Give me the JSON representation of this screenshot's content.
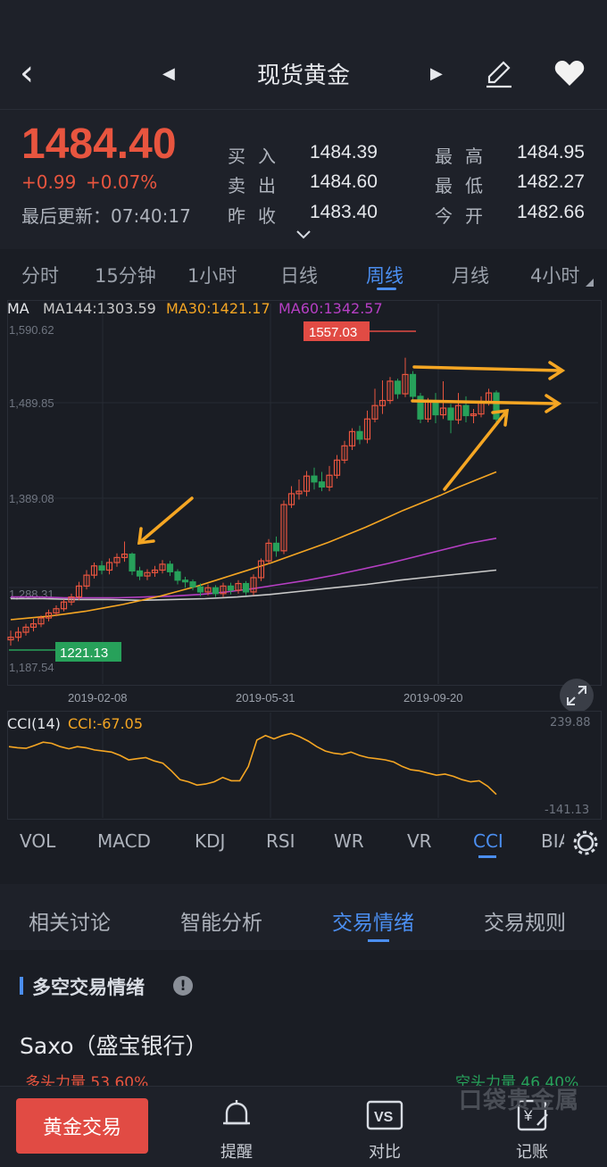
{
  "header": {
    "title": "现货黄金",
    "back_icon": "‹",
    "prev_icon": "◀",
    "next_icon": "▶"
  },
  "quote": {
    "price": "1484.40",
    "change": "+0.99",
    "change_pct": "+0.07%",
    "last_update": "最后更新：07:40:17",
    "buy_label": "买入",
    "buy": "1484.39",
    "sell_label": "卖出",
    "sell": "1484.60",
    "prev_label": "昨收",
    "prev": "1483.40",
    "high_label": "最高",
    "high": "1484.95",
    "low_label": "最低",
    "low": "1482.27",
    "open_label": "今开",
    "open": "1482.66"
  },
  "timeframes": [
    "分时",
    "15分钟",
    "1小时",
    "日线",
    "周线",
    "月线",
    "4小时"
  ],
  "active_timeframe": "周线",
  "ma_legend": {
    "ma": "MA",
    "ma144": "MA144:1303.59",
    "ma30": "MA30:1421.17",
    "ma60": "MA60:1342.57"
  },
  "price_axis": [
    "1,590.62",
    "1,489.85",
    "1,389.08",
    "1,288.31",
    "1,187.54"
  ],
  "date_axis": [
    "2019-02-08",
    "2019-05-31",
    "2019-09-20"
  ],
  "labels": {
    "max": "1557.03",
    "min": "1221.13"
  },
  "cci": {
    "title": "CCI(14)",
    "value": "CCI:-67.05",
    "top": "239.88",
    "bottom": "-141.13"
  },
  "indicators": [
    "VOL",
    "MACD",
    "KDJ",
    "RSI",
    "WR",
    "VR",
    "CCI",
    "BIA"
  ],
  "active_indicator": "CCI",
  "sections": [
    "相关讨论",
    "智能分析",
    "交易情绪",
    "交易规则"
  ],
  "active_section": "交易情绪",
  "sentiment": {
    "heading": "多空交易情绪",
    "broker": "Saxo（盛宝银行）",
    "long": "多头力量 53.60%",
    "short": "空头力量 46.40%",
    "watermark": "口袋贵金属"
  },
  "bottom": {
    "trade_button": "黄金交易",
    "remind": "提醒",
    "compare": "对比",
    "journal": "记账"
  },
  "colors": {
    "up": "#e8553f",
    "down": "#27a15a",
    "accent": "#4b8ef0",
    "ma30": "#f5a623",
    "ma60": "#b63fc4",
    "ma144": "#c9c9c9"
  },
  "chart_data": {
    "type": "candlestick",
    "ylim": [
      1187.54,
      1590.62
    ],
    "x_ticks": [
      "2019-02-08",
      "2019-05-31",
      "2019-09-20"
    ],
    "candles": [
      [
        1221,
        1224,
        1214,
        1232
      ],
      [
        1224,
        1230,
        1219,
        1236
      ],
      [
        1230,
        1236,
        1226,
        1240
      ],
      [
        1236,
        1240,
        1231,
        1246
      ],
      [
        1240,
        1247,
        1236,
        1250
      ],
      [
        1247,
        1253,
        1243,
        1257
      ],
      [
        1253,
        1258,
        1249,
        1262
      ],
      [
        1258,
        1266,
        1255,
        1269
      ],
      [
        1266,
        1272,
        1262,
        1276
      ],
      [
        1272,
        1285,
        1268,
        1290
      ],
      [
        1285,
        1298,
        1281,
        1304
      ],
      [
        1298,
        1309,
        1294,
        1313
      ],
      [
        1309,
        1304,
        1299,
        1315
      ],
      [
        1304,
        1313,
        1299,
        1318
      ],
      [
        1313,
        1319,
        1308,
        1324
      ],
      [
        1319,
        1323,
        1314,
        1338
      ],
      [
        1323,
        1303,
        1298,
        1325
      ],
      [
        1303,
        1297,
        1292,
        1308
      ],
      [
        1297,
        1301,
        1292,
        1305
      ],
      [
        1301,
        1304,
        1296,
        1309
      ],
      [
        1304,
        1311,
        1300,
        1316
      ],
      [
        1311,
        1302,
        1297,
        1315
      ],
      [
        1302,
        1292,
        1287,
        1305
      ],
      [
        1292,
        1290,
        1283,
        1296
      ],
      [
        1290,
        1284,
        1280,
        1293
      ],
      [
        1284,
        1278,
        1273,
        1288
      ],
      [
        1278,
        1283,
        1274,
        1287
      ],
      [
        1283,
        1276,
        1272,
        1286
      ],
      [
        1276,
        1285,
        1272,
        1289
      ],
      [
        1285,
        1280,
        1275,
        1289
      ],
      [
        1280,
        1288,
        1276,
        1292
      ],
      [
        1288,
        1278,
        1274,
        1291
      ],
      [
        1278,
        1295,
        1274,
        1299
      ],
      [
        1295,
        1315,
        1291,
        1318
      ],
      [
        1315,
        1336,
        1311,
        1341
      ],
      [
        1336,
        1327,
        1320,
        1344
      ],
      [
        1327,
        1382,
        1323,
        1387
      ],
      [
        1382,
        1395,
        1378,
        1404
      ],
      [
        1395,
        1398,
        1388,
        1412
      ],
      [
        1398,
        1416,
        1392,
        1422
      ],
      [
        1416,
        1409,
        1400,
        1426
      ],
      [
        1409,
        1403,
        1398,
        1421
      ],
      [
        1403,
        1417,
        1398,
        1428
      ],
      [
        1417,
        1435,
        1413,
        1441
      ],
      [
        1435,
        1452,
        1431,
        1458
      ],
      [
        1452,
        1469,
        1447,
        1473
      ],
      [
        1469,
        1460,
        1454,
        1476
      ],
      [
        1460,
        1484,
        1455,
        1494
      ],
      [
        1484,
        1500,
        1480,
        1520
      ],
      [
        1500,
        1506,
        1490,
        1530
      ],
      [
        1506,
        1529,
        1502,
        1534
      ],
      [
        1529,
        1514,
        1508,
        1532
      ],
      [
        1514,
        1537,
        1510,
        1557
      ],
      [
        1537,
        1511,
        1506,
        1541
      ],
      [
        1511,
        1484,
        1479,
        1515
      ],
      [
        1484,
        1504,
        1480,
        1509
      ],
      [
        1504,
        1489,
        1479,
        1515
      ],
      [
        1489,
        1497,
        1484,
        1529
      ],
      [
        1497,
        1483,
        1467,
        1502
      ],
      [
        1483,
        1500,
        1478,
        1515
      ],
      [
        1500,
        1488,
        1480,
        1511
      ],
      [
        1488,
        1490,
        1479,
        1496
      ],
      [
        1490,
        1505,
        1486,
        1511
      ],
      [
        1505,
        1515,
        1500,
        1520
      ],
      [
        1515,
        1484,
        1480,
        1518
      ]
    ],
    "ma30": [
      1245,
      1247,
      1249,
      1252,
      1255,
      1259,
      1263,
      1268,
      1273,
      1279,
      1285,
      1292,
      1299,
      1306,
      1313,
      1321,
      1329,
      1337,
      1346,
      1355,
      1365,
      1375,
      1384,
      1393,
      1403,
      1412,
      1421
    ],
    "ma60": [
      1272,
      1272,
      1271,
      1271,
      1271,
      1272,
      1273,
      1275,
      1278,
      1282,
      1287,
      1292,
      1298,
      1305,
      1312,
      1320,
      1328,
      1336,
      1342
    ],
    "ma144": [
      1270,
      1270,
      1269,
      1269,
      1268,
      1269,
      1270,
      1272,
      1275,
      1279,
      1283,
      1287,
      1292,
      1296,
      1300,
      1304
    ],
    "cci": [
      150,
      145,
      142,
      155,
      170,
      165,
      150,
      140,
      150,
      145,
      135,
      130,
      125,
      110,
      90,
      95,
      100,
      85,
      75,
      40,
      0,
      -10,
      -25,
      -20,
      -10,
      10,
      -5,
      -5,
      60,
      180,
      200,
      185,
      200,
      210,
      195,
      175,
      150,
      130,
      120,
      115,
      125,
      110,
      100,
      95,
      90,
      80,
      60,
      45,
      40,
      30,
      20,
      25,
      15,
      0,
      -10,
      -5,
      -30,
      -67
    ]
  }
}
